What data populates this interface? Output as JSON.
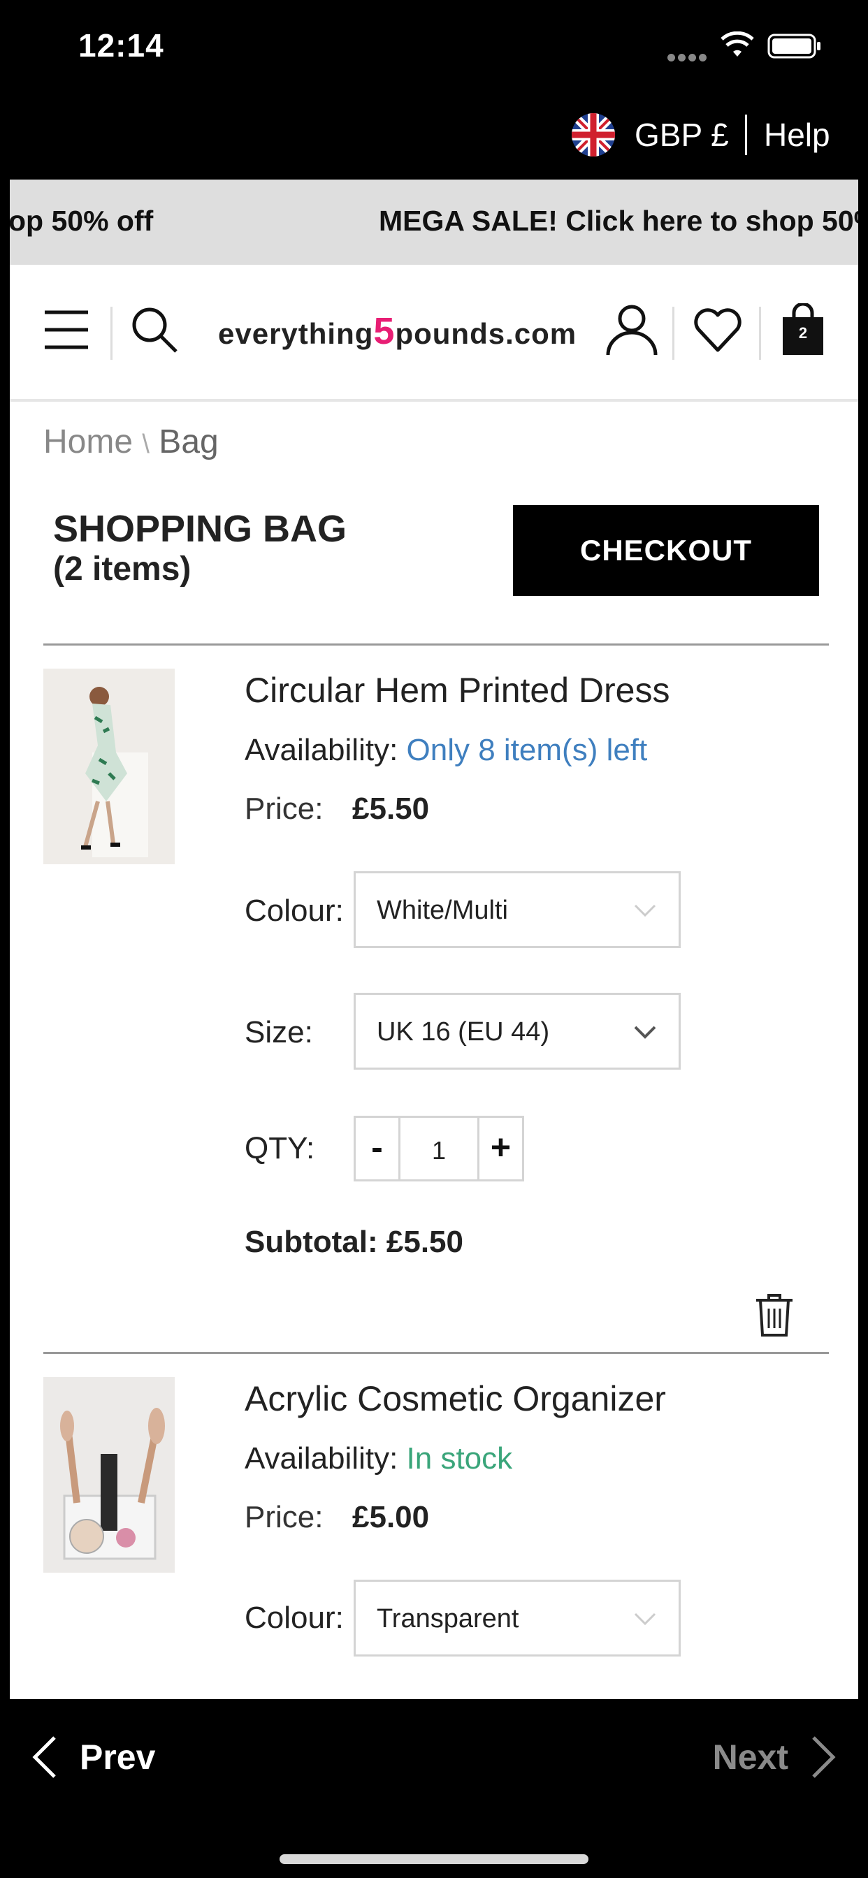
{
  "status_bar": {
    "time": "12:14"
  },
  "utility": {
    "currency": "GBP £",
    "help": "Help"
  },
  "promo": {
    "text_a": "op 50% off",
    "text_b": "MEGA SALE! Click here to shop 50%"
  },
  "header": {
    "logo_prefix": "everything",
    "logo_five": "5",
    "logo_suffix": "pounds.com",
    "bag_count": "2"
  },
  "breadcrumb": {
    "home": "Home",
    "separator": "\\",
    "current": "Bag"
  },
  "bag": {
    "title": "SHOPPING BAG",
    "count": "(2 items)",
    "checkout_label": "CHECKOUT"
  },
  "items": [
    {
      "name": "Circular Hem Printed Dress",
      "availability_label": "Availability:",
      "availability_value": "Only 8 item(s) left",
      "availability_color": "#3f7fbf",
      "price_label": "Price:",
      "price": "£5.50",
      "colour_label": "Colour:",
      "colour": "White/Multi",
      "size_label": "Size:",
      "size": "UK 16 (EU 44)",
      "qty_label": "QTY:",
      "qty_minus": "-",
      "qty": "1",
      "qty_plus": "+",
      "subtotal_label": "Subtotal:",
      "subtotal": "£5.50"
    },
    {
      "name": "Acrylic Cosmetic Organizer",
      "availability_label": "Availability:",
      "availability_value": "In stock",
      "availability_color": "#3aa57a",
      "price_label": "Price:",
      "price": "£5.00",
      "colour_label": "Colour:",
      "colour": "Transparent"
    }
  ],
  "nav": {
    "prev": "Prev",
    "next": "Next"
  },
  "colors": {
    "brand_pink": "#e81e74",
    "banner_bg": "#dedede",
    "checkout_bg": "#000000"
  }
}
